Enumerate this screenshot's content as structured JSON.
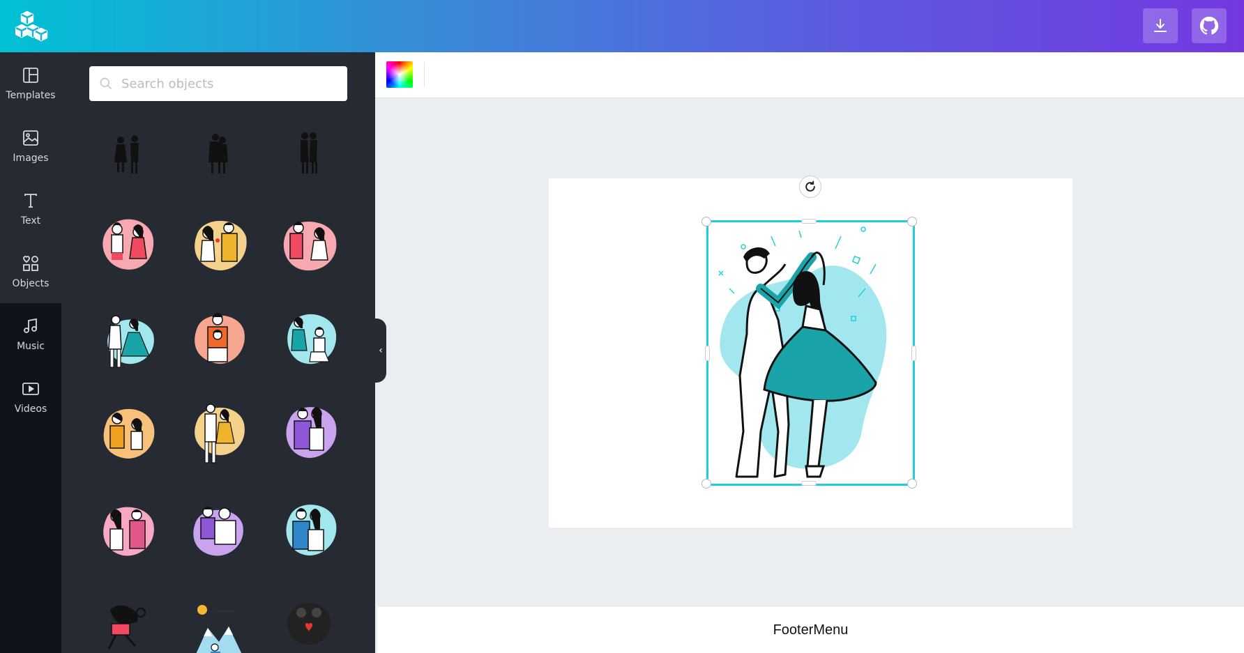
{
  "header": {
    "logo_icon": "cubes-logo-icon",
    "download_icon": "download-icon",
    "github_icon": "github-icon"
  },
  "rail": {
    "items": [
      {
        "label": "Templates",
        "icon": "layout-icon"
      },
      {
        "label": "Images",
        "icon": "image-icon"
      },
      {
        "label": "Text",
        "icon": "text-icon"
      },
      {
        "label": "Objects",
        "icon": "shapes-icon"
      },
      {
        "label": "Music",
        "icon": "music-note-icon"
      },
      {
        "label": "Videos",
        "icon": "video-icon"
      }
    ],
    "active": "Objects"
  },
  "panel": {
    "search_placeholder": "Search objects",
    "thumb_count": 18
  },
  "toolbar": {
    "color_swatch": "color-picker-icon"
  },
  "footer": {
    "label": "FooterMenu"
  },
  "colors": {
    "accent": "#1ecfd9",
    "teal": "#1aa3a8",
    "light_teal": "#a3e7ee",
    "dark_panel": "#252a33",
    "rail": "#0f141b"
  }
}
